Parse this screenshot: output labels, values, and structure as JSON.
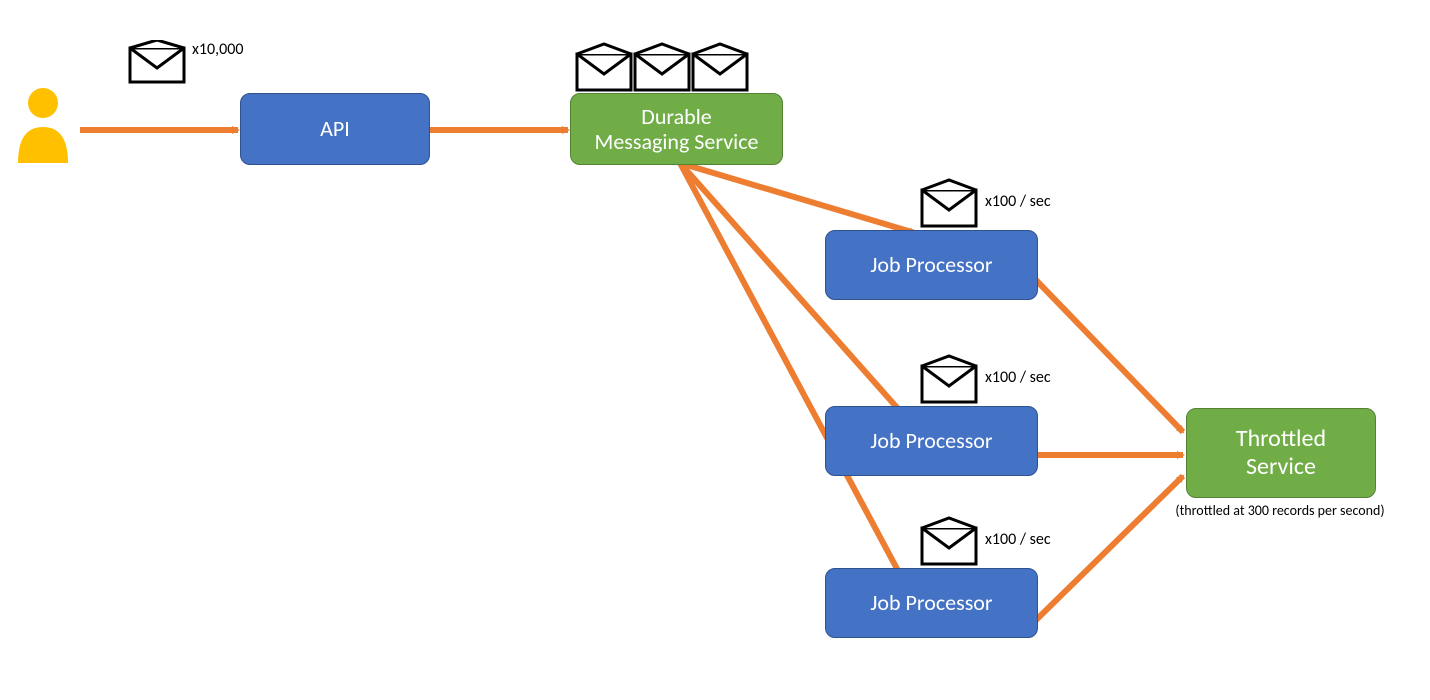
{
  "colors": {
    "blue": "#4472C4",
    "green": "#70AD47",
    "arrow": "#ED7D31",
    "user": "#FFC000",
    "envelope_stroke": "#000000"
  },
  "nodes": {
    "api": {
      "label": "API"
    },
    "messaging": {
      "label": "Durable\nMessaging Service"
    },
    "job1": {
      "label": "Job Processor"
    },
    "job2": {
      "label": "Job Processor"
    },
    "job3": {
      "label": "Job Processor"
    },
    "throttled": {
      "label": "Throttled\nService"
    }
  },
  "annotations": {
    "user_envelope": "x10,000",
    "job1_rate": "x100 / sec",
    "job2_rate": "x100 / sec",
    "job3_rate": "x100 / sec",
    "throttled_caption": "(throttled at 300 records per second)"
  }
}
